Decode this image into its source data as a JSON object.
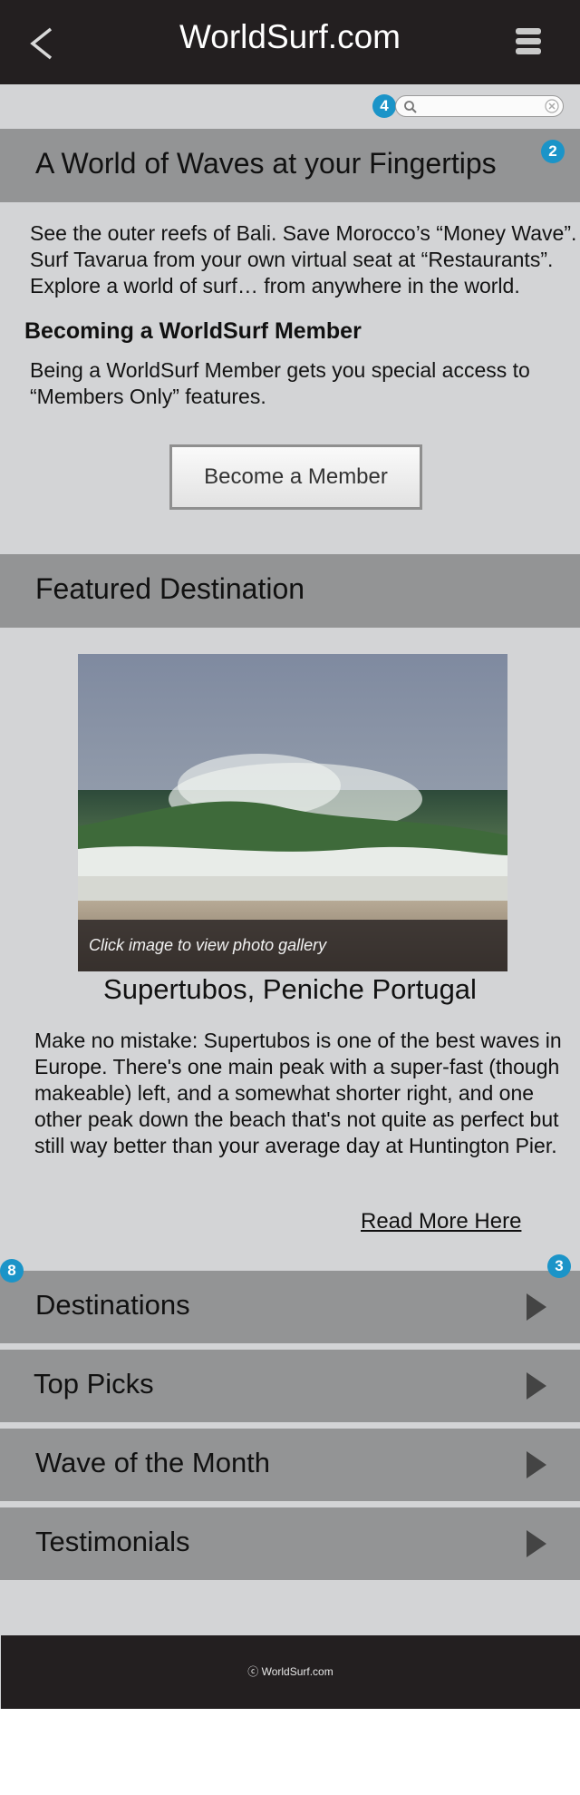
{
  "header": {
    "title": "WorldSurf.com",
    "back_icon": "chevron-left-icon",
    "menu_icon": "hamburger-menu-icon"
  },
  "search": {
    "placeholder": "",
    "value": "",
    "icon": "search-icon",
    "clear_icon": "clear-icon"
  },
  "badges": {
    "search": "4",
    "intro": "2",
    "nav_left": "8",
    "nav_right": "3"
  },
  "intro": {
    "heading": "A World of Waves at your Fingertips",
    "lines": [
      "See the outer reefs of Bali. Save Morocco’s “Money Wave”.",
      "Surf Tavarua from your own virtual seat at “Restaurants”.",
      "Explore a world of surf… from anywhere in the world."
    ]
  },
  "membership": {
    "heading": "Becoming a WorldSurf Member",
    "lines": [
      "Being a WorldSurf Member gets you special access to",
      "“Members Only” features."
    ],
    "button_label": "Become a Member"
  },
  "featured": {
    "heading": "Featured Destination",
    "caption": "Click image to view photo gallery",
    "name": "Supertubos, Peniche Portugal",
    "description": "Make no mistake: Supertubos is one of the best waves in Europe. There's one main peak with a super-fast (though makeable) left, and a somewhat shorter right, and one other peak down the beach that's not quite as perfect but still way better than your average day at Huntington Pier.",
    "read_more": "Read More Here"
  },
  "nav_items": [
    {
      "label": "Destinations",
      "icon": "triangle-right-icon"
    },
    {
      "label": "Top Picks",
      "icon": "triangle-right-icon"
    },
    {
      "label": "Wave of the Month",
      "icon": "triangle-right-icon"
    },
    {
      "label": "Testimonials",
      "icon": "triangle-right-icon"
    }
  ],
  "footer": {
    "copyright": "ⓒ WorldSurf.com"
  },
  "colors": {
    "header_bg": "#231f20",
    "page_bg": "#d3d4d6",
    "band_bg": "#939495",
    "badge": "#1b94c8"
  }
}
